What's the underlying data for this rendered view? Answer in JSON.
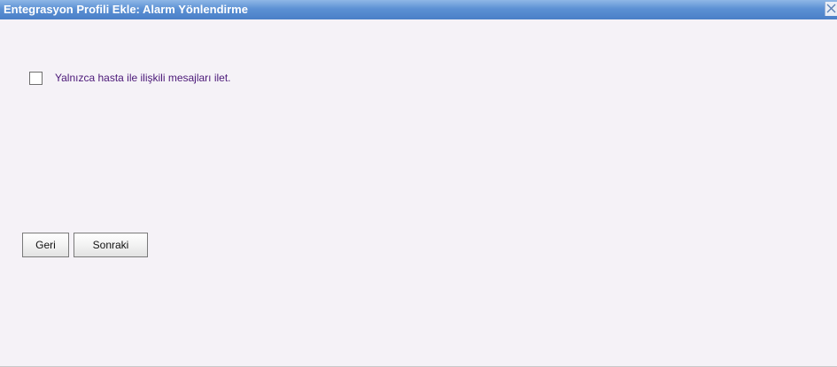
{
  "dialog": {
    "title": "Entegrasyon Profili Ekle: Alarm Yönlendirme",
    "close_icon": "close-icon"
  },
  "option": {
    "label": "Yalnızca hasta ile ilişkili mesajları ilet.",
    "checked": false
  },
  "buttons": {
    "back_label": "Geri",
    "next_label": "Sonraki"
  },
  "colors": {
    "titlebar": "#5c91d4",
    "background": "#f5f2f7",
    "label_text": "#4b1878"
  }
}
